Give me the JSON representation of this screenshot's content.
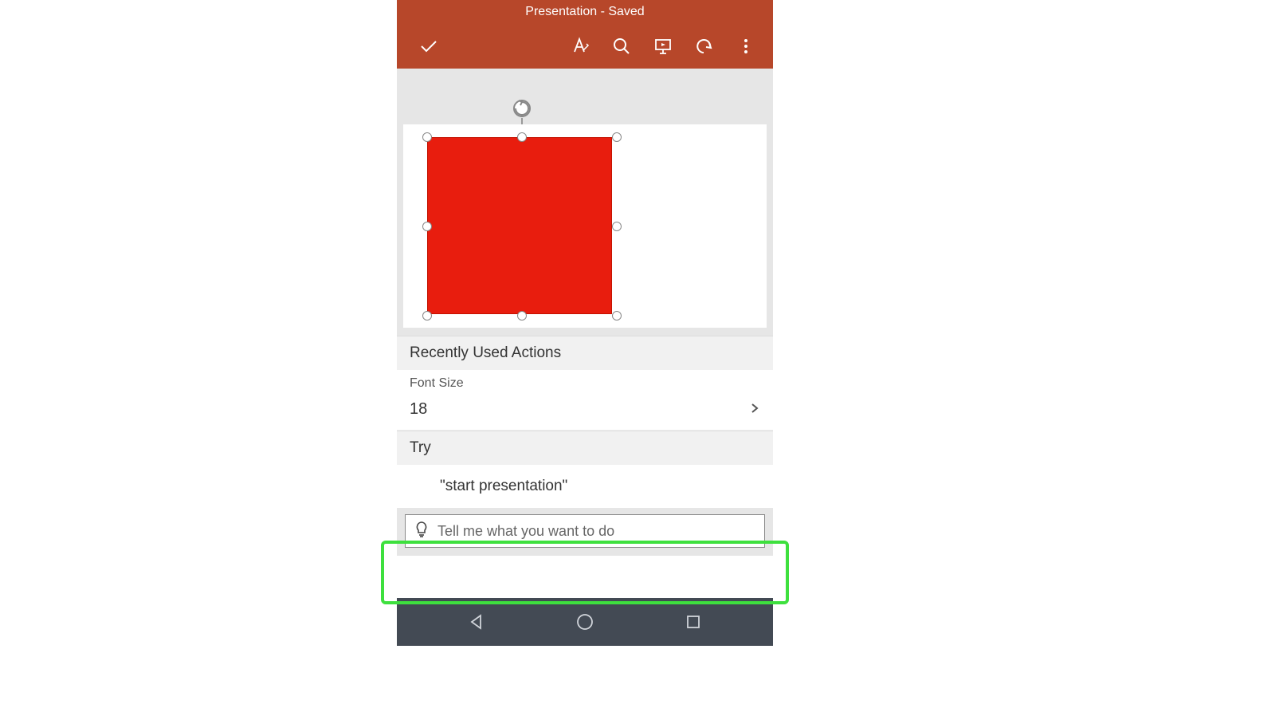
{
  "header": {
    "title": "Presentation - Saved"
  },
  "toolbar": {
    "icons": {
      "done": "done-check-icon",
      "font": "font-format-icon",
      "search": "search-icon",
      "present": "present-slideshow-icon",
      "undo": "undo-icon",
      "more": "more-vertical-icon"
    }
  },
  "slide": {
    "shape_color": "#e81d0e"
  },
  "panel": {
    "recent_header": "Recently Used Actions",
    "font_size_label": "Font Size",
    "font_size_value": "18",
    "try_header": "Try",
    "try_suggestion": "\"start presentation\""
  },
  "tellme": {
    "placeholder": "Tell me what you want to do"
  },
  "android_nav": {
    "back": "back-triangle-icon",
    "home": "home-circle-icon",
    "recent": "recent-square-icon"
  }
}
